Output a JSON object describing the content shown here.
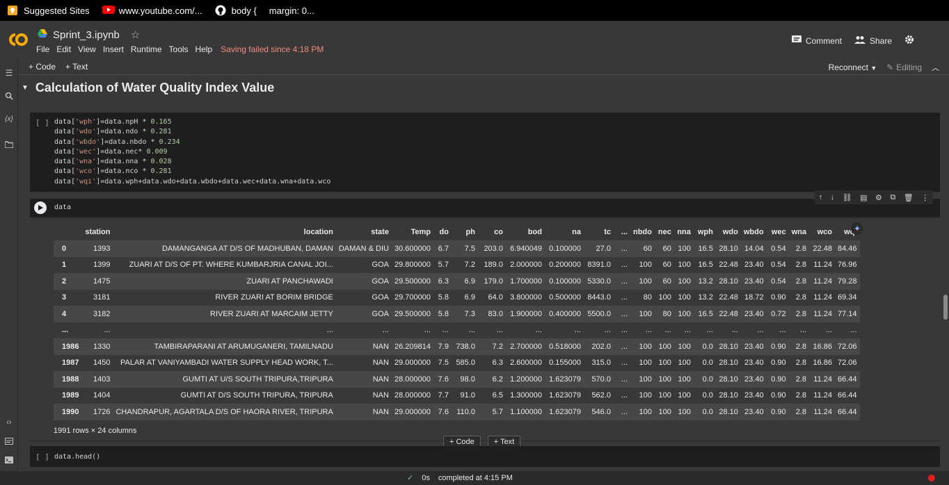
{
  "bookmarks": [
    {
      "label": "Suggested Sites",
      "icon": "lightbulb-icon"
    },
    {
      "label": "www.youtube.com/...",
      "icon": "youtube-icon"
    },
    {
      "label": "body {",
      "icon": "github-icon"
    },
    {
      "label": "margin: 0...",
      "icon": ""
    }
  ],
  "colab": {
    "notebook_title": "Sprint_3.ipynb",
    "menu": [
      "File",
      "Edit",
      "View",
      "Insert",
      "Runtime",
      "Tools",
      "Help"
    ],
    "save_status": "Saving failed since 4:18 PM",
    "comment_label": "Comment",
    "share_label": "Share"
  },
  "toolbar": {
    "add_code": "+ Code",
    "add_text": "+ Text",
    "reconnect": "Reconnect",
    "editing": "Editing"
  },
  "section": {
    "title": "Calculation of Water Quality Index Value"
  },
  "cell1": {
    "bracket": "[ ]",
    "lines": [
      {
        "a": "data[",
        "s": "'wph'",
        "b": "]=data.npH * ",
        "n": "0.165"
      },
      {
        "a": "data[",
        "s": "'wdo'",
        "b": "]=data.ndo * ",
        "n": "0.281"
      },
      {
        "a": "data[",
        "s": "'wbdo'",
        "b": "]=data.nbdo * ",
        "n": "0.234"
      },
      {
        "a": "data[",
        "s": "'wec'",
        "b": "]=data.nec* ",
        "n": "0.009"
      },
      {
        "a": "data[",
        "s": "'wna'",
        "b": "]=data.nna * ",
        "n": "0.028"
      },
      {
        "a": "data[",
        "s": "'wco'",
        "b": "]=data.nco * ",
        "n": "0.281"
      },
      {
        "a": "data[",
        "s": "'wqi'",
        "b": "]=data.wph+data.wdo+data.wbdo+data.wec+data.wna+data.wco",
        "n": ""
      }
    ]
  },
  "cell2": {
    "code": "data",
    "columns": [
      "",
      "station",
      "location",
      "state",
      "Temp",
      "do",
      "ph",
      "co",
      "bod",
      "na",
      "tc",
      "...",
      "nbdo",
      "nec",
      "nna",
      "wph",
      "wdo",
      "wbdo",
      "wec",
      "wna",
      "wco",
      "wqi"
    ],
    "rows": [
      [
        "0",
        "1393",
        "DAMANGANGA AT D/S OF MADHUBAN, DAMAN",
        "DAMAN & DIU",
        "30.600000",
        "6.7",
        "7.5",
        "203.0",
        "6.940049",
        "0.100000",
        "27.0",
        "...",
        "60",
        "60",
        "100",
        "16.5",
        "28.10",
        "14.04",
        "0.54",
        "2.8",
        "22.48",
        "84.46"
      ],
      [
        "1",
        "1399",
        "ZUARI AT D/S OF PT. WHERE KUMBARJRIA CANAL JOI...",
        "GOA",
        "29.800000",
        "5.7",
        "7.2",
        "189.0",
        "2.000000",
        "0.200000",
        "8391.0",
        "...",
        "100",
        "60",
        "100",
        "16.5",
        "22.48",
        "23.40",
        "0.54",
        "2.8",
        "11.24",
        "76.96"
      ],
      [
        "2",
        "1475",
        "ZUARI AT PANCHAWADI",
        "GOA",
        "29.500000",
        "6.3",
        "6.9",
        "179.0",
        "1.700000",
        "0.100000",
        "5330.0",
        "...",
        "100",
        "60",
        "100",
        "13.2",
        "28.10",
        "23.40",
        "0.54",
        "2.8",
        "11.24",
        "79.28"
      ],
      [
        "3",
        "3181",
        "RIVER ZUARI AT BORIM BRIDGE",
        "GOA",
        "29.700000",
        "5.8",
        "6.9",
        "64.0",
        "3.800000",
        "0.500000",
        "8443.0",
        "...",
        "80",
        "100",
        "100",
        "13.2",
        "22.48",
        "18.72",
        "0.90",
        "2.8",
        "11.24",
        "69.34"
      ],
      [
        "4",
        "3182",
        "RIVER ZUARI AT MARCAIM JETTY",
        "GOA",
        "29.500000",
        "5.8",
        "7.3",
        "83.0",
        "1.900000",
        "0.400000",
        "5500.0",
        "...",
        "100",
        "80",
        "100",
        "16.5",
        "22.48",
        "23.40",
        "0.72",
        "2.8",
        "11.24",
        "77.14"
      ],
      [
        "...",
        "...",
        "...",
        "...",
        "...",
        "...",
        "...",
        "...",
        "...",
        "...",
        "...",
        "...",
        "...",
        "...",
        "...",
        "...",
        "...",
        "...",
        "...",
        "...",
        "...",
        "..."
      ],
      [
        "1986",
        "1330",
        "TAMBIRAPARANI AT ARUMUGANERI, TAMILNADU",
        "NAN",
        "26.209814",
        "7.9",
        "738.0",
        "7.2",
        "2.700000",
        "0.518000",
        "202.0",
        "...",
        "100",
        "100",
        "100",
        "0.0",
        "28.10",
        "23.40",
        "0.90",
        "2.8",
        "16.86",
        "72.06"
      ],
      [
        "1987",
        "1450",
        "PALAR AT VANIYAMBADI WATER SUPPLY HEAD WORK, T...",
        "NAN",
        "29.000000",
        "7.5",
        "585.0",
        "6.3",
        "2.600000",
        "0.155000",
        "315.0",
        "...",
        "100",
        "100",
        "100",
        "0.0",
        "28.10",
        "23.40",
        "0.90",
        "2.8",
        "16.86",
        "72.06"
      ],
      [
        "1988",
        "1403",
        "GUMTI AT U/S SOUTH TRIPURA,TRIPURA",
        "NAN",
        "28.000000",
        "7.6",
        "98.0",
        "6.2",
        "1.200000",
        "1.623079",
        "570.0",
        "...",
        "100",
        "100",
        "100",
        "0.0",
        "28.10",
        "23.40",
        "0.90",
        "2.8",
        "11.24",
        "66.44"
      ],
      [
        "1989",
        "1404",
        "GUMTI AT D/S SOUTH TRIPURA, TRIPURA",
        "NAN",
        "28.000000",
        "7.7",
        "91.0",
        "6.5",
        "1.300000",
        "1.623079",
        "562.0",
        "...",
        "100",
        "100",
        "100",
        "0.0",
        "28.10",
        "23.40",
        "0.90",
        "2.8",
        "11.24",
        "66.44"
      ],
      [
        "1990",
        "1726",
        "CHANDRAPUR, AGARTALA D/S OF HAORA RIVER, TRIPURA",
        "NAN",
        "29.000000",
        "7.6",
        "110.0",
        "5.7",
        "1.100000",
        "1.623079",
        "546.0",
        "...",
        "100",
        "100",
        "100",
        "0.0",
        "28.10",
        "23.40",
        "0.90",
        "2.8",
        "11.24",
        "66.44"
      ]
    ],
    "shape_text": "1991 rows × 24 columns"
  },
  "add_cell": {
    "code": "+ Code",
    "text": "+ Text"
  },
  "cell3": {
    "bracket": "[ ]",
    "code": "data.head()"
  },
  "status": {
    "time": "0s",
    "text": "completed at 4:15 PM"
  }
}
